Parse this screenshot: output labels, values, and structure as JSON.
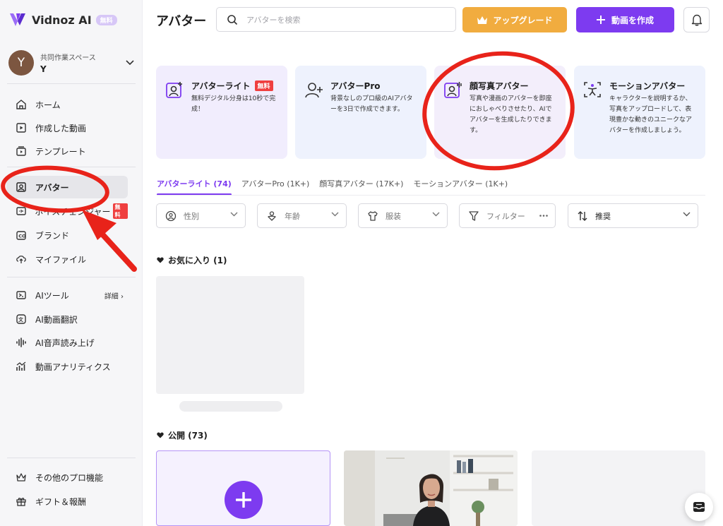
{
  "app": {
    "name": "Vidnoz AI",
    "free_badge": "無料"
  },
  "workspace": {
    "label": "共同作業スペース",
    "initial": "Y",
    "name": "Y"
  },
  "sidebar": {
    "items": [
      {
        "label": "ホーム",
        "icon": "home-icon"
      },
      {
        "label": "作成した動画",
        "icon": "video-icon"
      },
      {
        "label": "テンプレート",
        "icon": "template-icon"
      },
      {
        "label": "アバター",
        "icon": "avatar-icon",
        "active": true
      },
      {
        "label": "ボイスチェンジャー",
        "icon": "voice-icon",
        "badge": "無料"
      },
      {
        "label": "ブランド",
        "icon": "brand-icon"
      },
      {
        "label": "マイファイル",
        "icon": "upload-icon"
      },
      {
        "label": "AIツール",
        "icon": "ai-tools-icon",
        "detail": "詳細"
      },
      {
        "label": "AI動画翻訳",
        "icon": "translate-icon"
      },
      {
        "label": "AI音声読み上げ",
        "icon": "waveform-icon"
      },
      {
        "label": "動画アナリティクス",
        "icon": "analytics-icon"
      },
      {
        "label": "その他のプロ機能",
        "icon": "crown-icon"
      },
      {
        "label": "ギフト＆報酬",
        "icon": "gift-icon"
      }
    ]
  },
  "header": {
    "title": "アバター",
    "search_placeholder": "アバターを検索",
    "upgrade_label": "アップグレード",
    "create_label": "動画を作成"
  },
  "cards": [
    {
      "title": "アバターライト",
      "badge": "無料",
      "desc": "無料デジタル分身は10秒で完成！"
    },
    {
      "title": "アバターPro",
      "desc": "背景なしのプロ級のAIアバターを3日で作成できます。"
    },
    {
      "title": "顔写真アバター",
      "desc": "写真や漫画のアバターを即座におしゃべりさせたり、AIでアバターを生成したりできます。"
    },
    {
      "title": "モーションアバター",
      "desc": "キャラクターを説明するか、写真をアップロードして、表現豊かな動きのユニークなアバターを作成しましょう。"
    }
  ],
  "tabs": [
    {
      "label": "アバターライト (74)"
    },
    {
      "label": "アバターPro (1K+)"
    },
    {
      "label": "顔写真アバター (17K+)"
    },
    {
      "label": "モーションアバター (1K+)"
    }
  ],
  "filters": {
    "gender": "性別",
    "age": "年齢",
    "clothing": "服装",
    "filter": "フィルター",
    "sort": "推奨"
  },
  "sections": {
    "favorites": "お気に入り (1)",
    "public": "公開 (73)"
  },
  "colors": {
    "accent": "#7d3bf0",
    "upgrade": "#f1ac3f",
    "annotation": "#e8231a",
    "badge": "#ef3f3f"
  }
}
